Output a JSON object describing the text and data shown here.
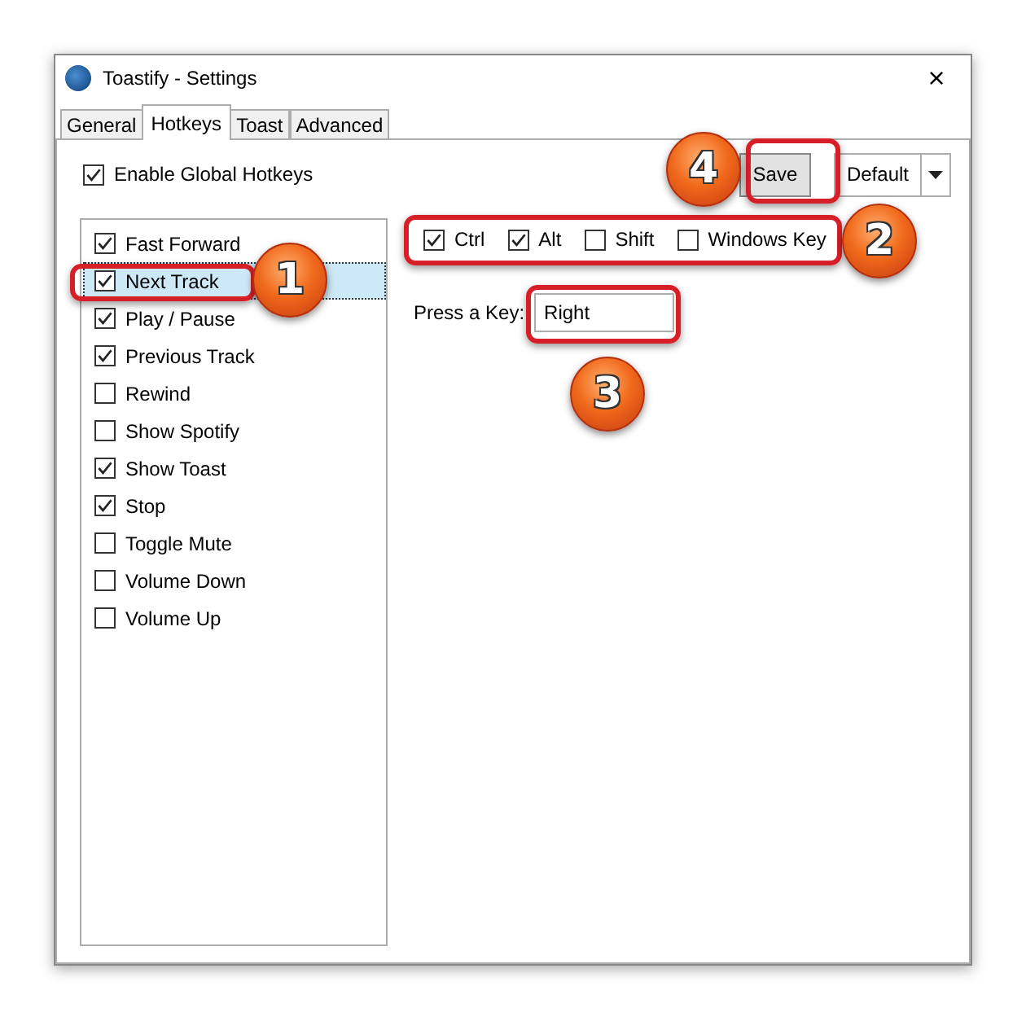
{
  "window": {
    "title": "Toastify - Settings",
    "close": "×"
  },
  "tabs": [
    {
      "label": "General",
      "selected": false
    },
    {
      "label": "Hotkeys",
      "selected": true
    },
    {
      "label": "Toast",
      "selected": false
    },
    {
      "label": "Advanced",
      "selected": false
    }
  ],
  "enable_global_hotkeys": {
    "label": "Enable Global Hotkeys",
    "checked": true
  },
  "hotkeys": [
    {
      "label": "Fast Forward",
      "checked": true,
      "selected": false
    },
    {
      "label": "Next Track",
      "checked": true,
      "selected": true
    },
    {
      "label": "Play / Pause",
      "checked": true,
      "selected": false
    },
    {
      "label": "Previous Track",
      "checked": true,
      "selected": false
    },
    {
      "label": "Rewind",
      "checked": false,
      "selected": false
    },
    {
      "label": "Show Spotify",
      "checked": false,
      "selected": false
    },
    {
      "label": "Show Toast",
      "checked": true,
      "selected": false
    },
    {
      "label": "Stop",
      "checked": true,
      "selected": false
    },
    {
      "label": "Toggle Mute",
      "checked": false,
      "selected": false
    },
    {
      "label": "Volume Down",
      "checked": false,
      "selected": false
    },
    {
      "label": "Volume Up",
      "checked": false,
      "selected": false
    }
  ],
  "modifiers": [
    {
      "label": "Ctrl",
      "checked": true
    },
    {
      "label": "Alt",
      "checked": true
    },
    {
      "label": "Shift",
      "checked": false
    },
    {
      "label": "Windows Key",
      "checked": false
    }
  ],
  "key_field": {
    "label": "Press a Key:",
    "value": "Right"
  },
  "buttons": {
    "save": "Save",
    "default": "Default"
  },
  "callouts": [
    {
      "number": "1"
    },
    {
      "number": "2"
    },
    {
      "number": "3"
    },
    {
      "number": "4"
    }
  ]
}
